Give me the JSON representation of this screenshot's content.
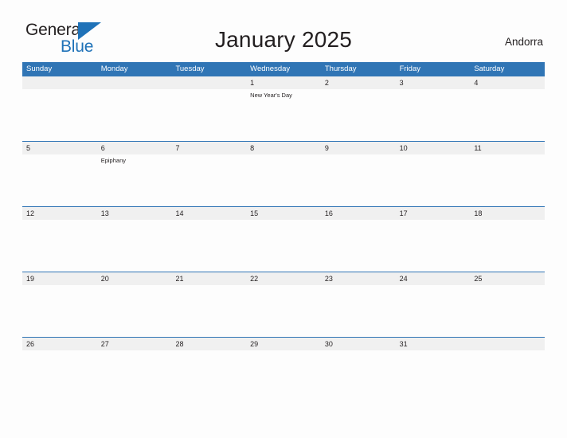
{
  "brand": {
    "name_part1": "General",
    "name_part2": "Blue",
    "triangle_icon": "triangle-icon",
    "accent_color": "#1f72b8"
  },
  "header": {
    "title": "January 2025",
    "location": "Andorra"
  },
  "theme": {
    "header_blue": "#3075b5",
    "date_band_gray": "#f0f0f0",
    "page_background": "#fdfdfd",
    "text_color": "#231f20"
  },
  "calendar": {
    "weekdays": [
      "Sunday",
      "Monday",
      "Tuesday",
      "Wednesday",
      "Thursday",
      "Friday",
      "Saturday"
    ],
    "weeks": [
      [
        {
          "date": "",
          "event": ""
        },
        {
          "date": "",
          "event": ""
        },
        {
          "date": "",
          "event": ""
        },
        {
          "date": "1",
          "event": "New Year's Day"
        },
        {
          "date": "2",
          "event": ""
        },
        {
          "date": "3",
          "event": ""
        },
        {
          "date": "4",
          "event": ""
        }
      ],
      [
        {
          "date": "5",
          "event": ""
        },
        {
          "date": "6",
          "event": "Epiphany"
        },
        {
          "date": "7",
          "event": ""
        },
        {
          "date": "8",
          "event": ""
        },
        {
          "date": "9",
          "event": ""
        },
        {
          "date": "10",
          "event": ""
        },
        {
          "date": "11",
          "event": ""
        }
      ],
      [
        {
          "date": "12",
          "event": ""
        },
        {
          "date": "13",
          "event": ""
        },
        {
          "date": "14",
          "event": ""
        },
        {
          "date": "15",
          "event": ""
        },
        {
          "date": "16",
          "event": ""
        },
        {
          "date": "17",
          "event": ""
        },
        {
          "date": "18",
          "event": ""
        }
      ],
      [
        {
          "date": "19",
          "event": ""
        },
        {
          "date": "20",
          "event": ""
        },
        {
          "date": "21",
          "event": ""
        },
        {
          "date": "22",
          "event": ""
        },
        {
          "date": "23",
          "event": ""
        },
        {
          "date": "24",
          "event": ""
        },
        {
          "date": "25",
          "event": ""
        }
      ],
      [
        {
          "date": "26",
          "event": ""
        },
        {
          "date": "27",
          "event": ""
        },
        {
          "date": "28",
          "event": ""
        },
        {
          "date": "29",
          "event": ""
        },
        {
          "date": "30",
          "event": ""
        },
        {
          "date": "31",
          "event": ""
        },
        {
          "date": "",
          "event": ""
        }
      ]
    ]
  }
}
